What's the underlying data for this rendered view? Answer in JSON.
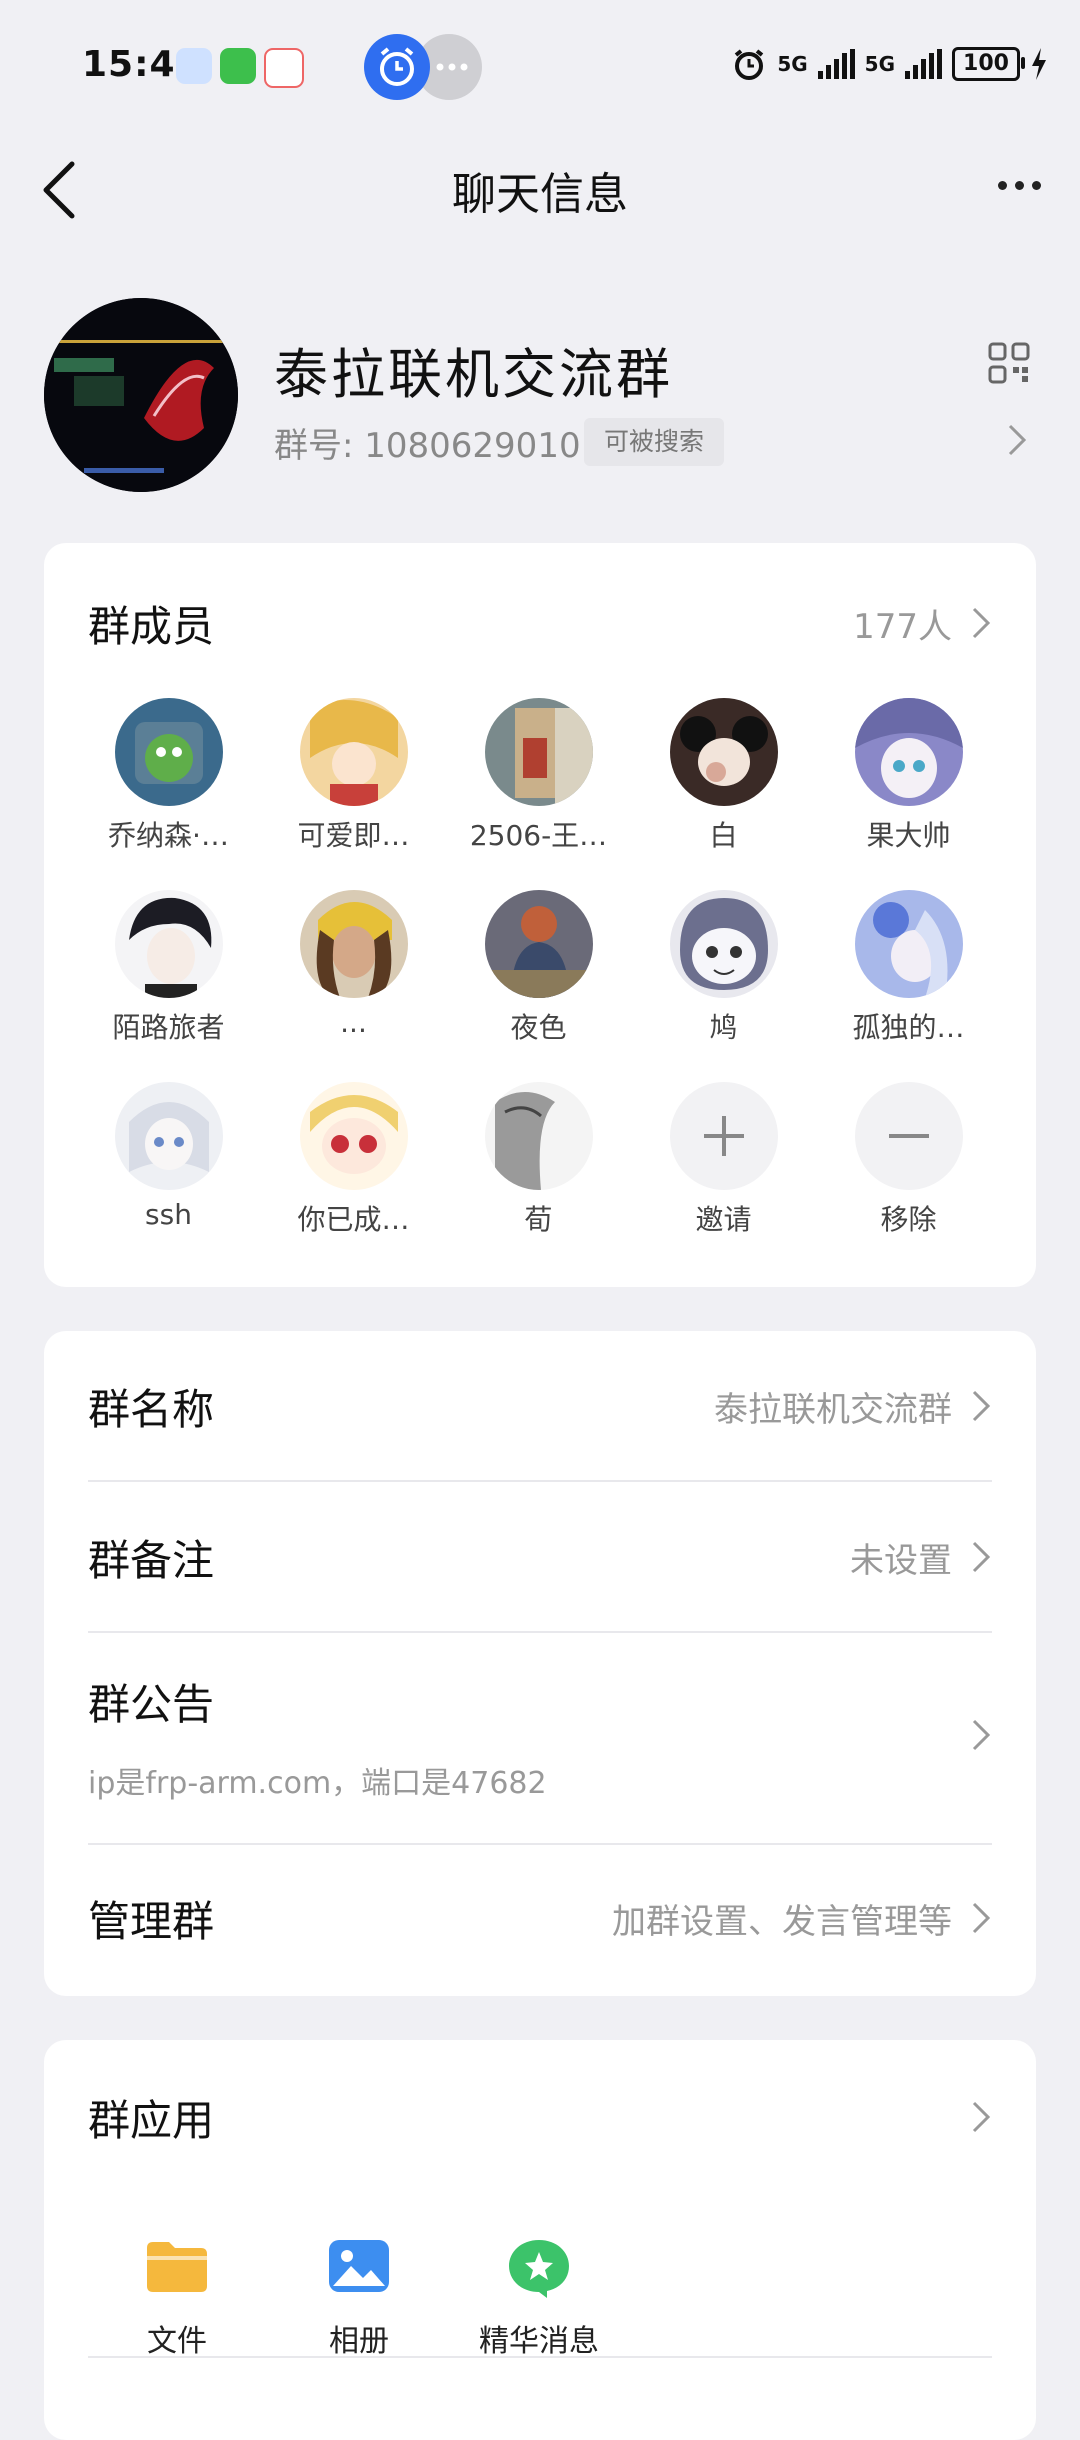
{
  "status_bar": {
    "time": "15:43",
    "network": "5G",
    "network2": "5G",
    "battery": "100"
  },
  "nav": {
    "title": "聊天信息"
  },
  "group": {
    "name": "泰拉联机交流群",
    "number_label": "群号: 1080629010",
    "search_tag": "可被搜索"
  },
  "members_section": {
    "title": "群成员",
    "count": "177人",
    "members": [
      {
        "name": "乔纳森·…",
        "color": "#3b6a8c"
      },
      {
        "name": "可爱即…",
        "color": "#e8c070"
      },
      {
        "name": "2506-王…",
        "color": "#9a8470"
      },
      {
        "name": "白",
        "color": "#3a2a26"
      },
      {
        "name": "果大帅",
        "color": "#8a88c8"
      },
      {
        "name": "陌路旅者",
        "color": "#2a2a30"
      },
      {
        "name": "...",
        "color": "#7a6048"
      },
      {
        "name": "夜色",
        "color": "#6a6a78"
      },
      {
        "name": "鸠",
        "color": "#6c6f8e"
      },
      {
        "name": "孤独的…",
        "color": "#a8b8ea"
      },
      {
        "name": "ssh",
        "color": "#d8dce6"
      },
      {
        "name": "你已成…",
        "color": "#f3d9a8"
      },
      {
        "name": "荀",
        "color": "#9a9a9a"
      }
    ],
    "invite_label": "邀请",
    "remove_label": "移除"
  },
  "settings": {
    "group_name_label": "群名称",
    "group_name_value": "泰拉联机交流群",
    "group_remark_label": "群备注",
    "group_remark_value": "未设置",
    "announcement_label": "群公告",
    "announcement_text": "ip是frp-arm.com，端口是47682",
    "manage_label": "管理群",
    "manage_value": "加群设置、发言管理等"
  },
  "apps_section": {
    "title": "群应用",
    "apps": [
      {
        "label": "文件",
        "icon": "folder-icon",
        "color": "#f5b83d"
      },
      {
        "label": "相册",
        "icon": "album-icon",
        "color": "#3d8ef0"
      },
      {
        "label": "精华消息",
        "icon": "star-chat-icon",
        "color": "#3cc36a"
      }
    ]
  }
}
